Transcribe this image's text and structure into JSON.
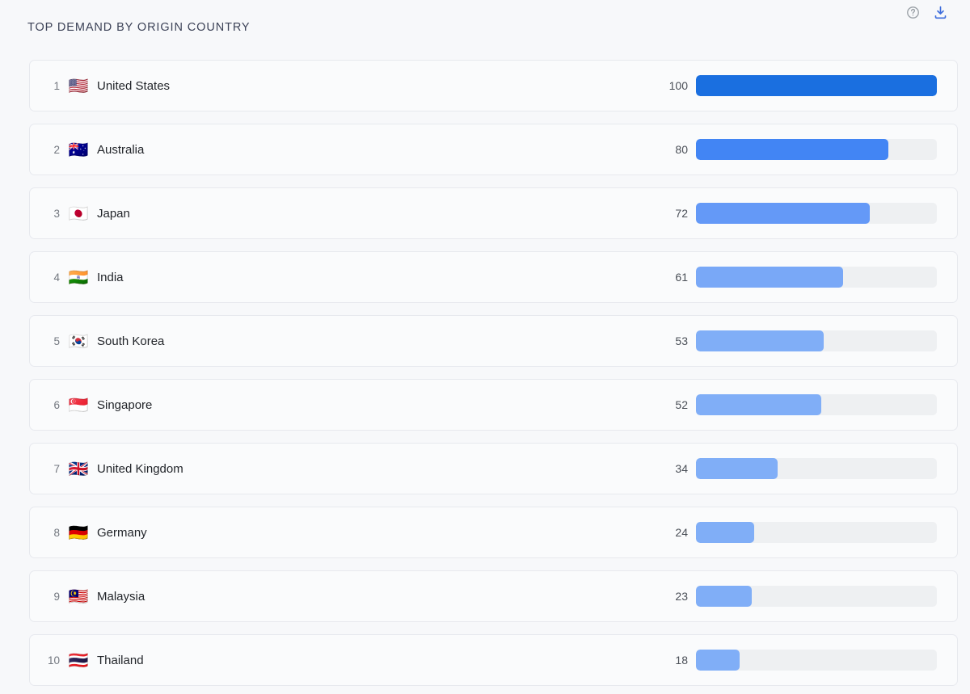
{
  "header": {
    "title": "TOP DEMAND BY ORIGIN COUNTRY",
    "help_icon": "help-circle-icon",
    "download_icon": "download-icon"
  },
  "colors": {
    "page_background": "#f7f8fa",
    "row_background": "#fafbfc",
    "row_border": "#e7e9ee",
    "bar_track": "#eef0f2",
    "title_text": "#3c4257",
    "country_text": "#22252a",
    "rank_text": "#72777f",
    "value_text": "#4a4f57",
    "download_accent": "#3d6ddc"
  },
  "chart_data": {
    "type": "bar",
    "title": "TOP DEMAND BY ORIGIN COUNTRY",
    "xlabel": "",
    "ylabel": "",
    "orientation": "horizontal",
    "grid": false,
    "legend": "none",
    "xlim": [
      0,
      100
    ],
    "categories": [
      "United States",
      "Australia",
      "Japan",
      "India",
      "South Korea",
      "Singapore",
      "United Kingdom",
      "Germany",
      "Malaysia",
      "Thailand"
    ],
    "values": [
      100,
      80,
      72,
      61,
      53,
      52,
      34,
      24,
      23,
      18
    ]
  },
  "rows": [
    {
      "rank": "1",
      "flag": "🇺🇸",
      "flag_name": "flag-united-states",
      "country": "United States",
      "value": "100",
      "pct": 100,
      "color": "#1a6fe0"
    },
    {
      "rank": "2",
      "flag": "🇦🇺",
      "flag_name": "flag-australia",
      "country": "Australia",
      "value": "80",
      "pct": 80,
      "color": "#4285f4"
    },
    {
      "rank": "3",
      "flag": "🇯🇵",
      "flag_name": "flag-japan",
      "country": "Japan",
      "value": "72",
      "pct": 72,
      "color": "#6499f7"
    },
    {
      "rank": "4",
      "flag": "🇮🇳",
      "flag_name": "flag-india",
      "country": "India",
      "value": "61",
      "pct": 61,
      "color": "#79a8f7"
    },
    {
      "rank": "5",
      "flag": "🇰🇷",
      "flag_name": "flag-south-korea",
      "country": "South Korea",
      "value": "53",
      "pct": 53,
      "color": "#80aef7"
    },
    {
      "rank": "6",
      "flag": "🇸🇬",
      "flag_name": "flag-singapore",
      "country": "Singapore",
      "value": "52",
      "pct": 52,
      "color": "#80aef7"
    },
    {
      "rank": "7",
      "flag": "🇬🇧",
      "flag_name": "flag-united-kingdom",
      "country": "United Kingdom",
      "value": "34",
      "pct": 34,
      "color": "#80aef7"
    },
    {
      "rank": "8",
      "flag": "🇩🇪",
      "flag_name": "flag-germany",
      "country": "Germany",
      "value": "24",
      "pct": 24,
      "color": "#80aef7"
    },
    {
      "rank": "9",
      "flag": "🇲🇾",
      "flag_name": "flag-malaysia",
      "country": "Malaysia",
      "value": "23",
      "pct": 23,
      "color": "#80aef7"
    },
    {
      "rank": "10",
      "flag": "🇹🇭",
      "flag_name": "flag-thailand",
      "country": "Thailand",
      "value": "18",
      "pct": 18,
      "color": "#80aef7"
    }
  ]
}
